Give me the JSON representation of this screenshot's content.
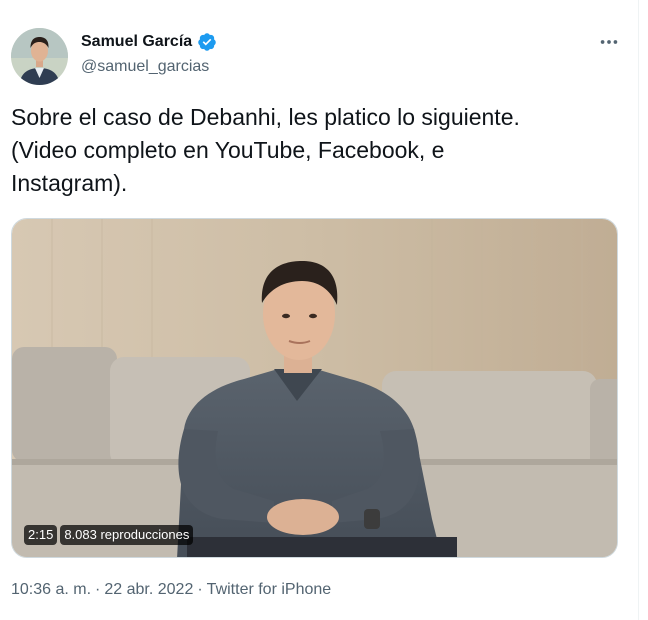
{
  "author": {
    "display_name": "Samuel García",
    "handle": "@samuel_garcias",
    "verified": true
  },
  "more_icon": "ellipsis-horizontal-icon",
  "tweet": {
    "text": "Sobre el caso de Debanhi, les platico lo siguiente.\n(Video completo en YouTube, Facebook, e\nInstagram)."
  },
  "video": {
    "duration": "2:15",
    "views": "8.083 reproducciones"
  },
  "meta": {
    "time": "10:36 a. m.",
    "separator": "·",
    "date": "22 abr. 2022",
    "source": "Twitter for iPhone"
  },
  "colors": {
    "text": "#0f1419",
    "secondary": "#536471",
    "verified": "#1d9bf0"
  }
}
